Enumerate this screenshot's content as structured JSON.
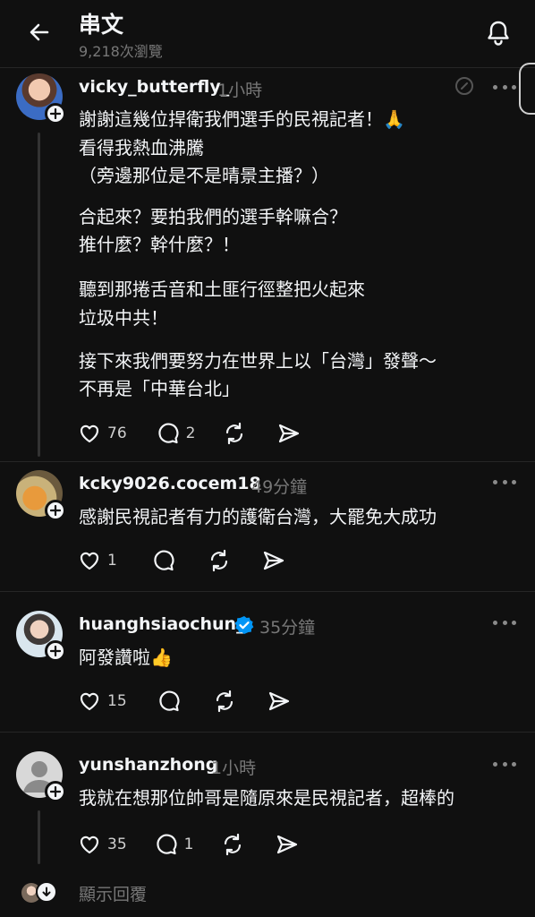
{
  "header": {
    "title": "串文",
    "views": "9,218次瀏覽"
  },
  "posts": [
    {
      "username": "vicky_butterfly_",
      "time": "1小時",
      "lines": [
        "謝謝這幾位捍衛我們選手的民視記者！🙏",
        "看得我熱血沸騰",
        "（旁邊那位是不是晴景主播？）",
        "合起來？要拍我們的選手幹嘛合？",
        "推什麼？幹什麼？！",
        "聽到那捲舌音和土匪行徑整把火起來",
        "垃圾中共！",
        "接下來我們要努力在世界上以「台灣」發聲～",
        "不再是「中華台北」"
      ],
      "likes": "76",
      "replies": "2"
    },
    {
      "username": "kcky9026.cocem18",
      "time": "49分鐘",
      "lines": [
        "感謝民視記者有力的護衛台灣，大罷免大成功"
      ],
      "likes": "1",
      "replies": ""
    },
    {
      "username": "huanghsiaochun_",
      "time": "35分鐘",
      "verified": true,
      "lines": [
        "阿發讚啦👍"
      ],
      "likes": "15",
      "replies": ""
    },
    {
      "username": "yunshanzhong",
      "time": "1小時",
      "lines": [
        "我就在想那位帥哥是隨原來是民視記者，超棒的"
      ],
      "likes": "35",
      "replies": "1"
    }
  ],
  "footer": {
    "show_replies": "顯示回覆"
  },
  "colors": {
    "background": "#101010",
    "text": "#f3f5f7",
    "muted": "#777777",
    "verified": "#0095f6"
  }
}
